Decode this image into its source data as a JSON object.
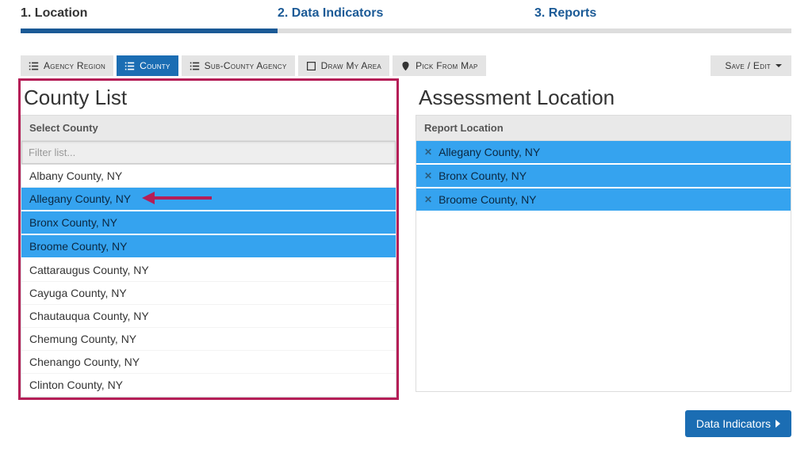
{
  "steps": [
    {
      "label": "1. Location",
      "active": true
    },
    {
      "label": "2. Data Indicators",
      "active": false
    },
    {
      "label": "3. Reports",
      "active": false
    }
  ],
  "toolbar": {
    "agency_region": "Agency Region",
    "county": "County",
    "sub_county": "Sub-County Agency",
    "draw": "Draw My Area",
    "pick": "Pick From Map",
    "save_edit": "Save / Edit"
  },
  "left": {
    "title": "County List",
    "header": "Select County",
    "filter_placeholder": "Filter list...",
    "items": [
      {
        "label": "Albany County, NY",
        "selected": false
      },
      {
        "label": "Allegany County, NY",
        "selected": true,
        "arrow": true
      },
      {
        "label": "Bronx County, NY",
        "selected": true
      },
      {
        "label": "Broome County, NY",
        "selected": true
      },
      {
        "label": "Cattaraugus County, NY",
        "selected": false
      },
      {
        "label": "Cayuga County, NY",
        "selected": false
      },
      {
        "label": "Chautauqua County, NY",
        "selected": false
      },
      {
        "label": "Chemung County, NY",
        "selected": false
      },
      {
        "label": "Chenango County, NY",
        "selected": false
      },
      {
        "label": "Clinton County, NY",
        "selected": false
      }
    ]
  },
  "right": {
    "title": "Assessment Location",
    "header": "Report Location",
    "items": [
      {
        "label": "Allegany County, NY"
      },
      {
        "label": "Bronx County, NY"
      },
      {
        "label": "Broome County, NY"
      }
    ]
  },
  "footer": {
    "next": "Data Indicators"
  }
}
